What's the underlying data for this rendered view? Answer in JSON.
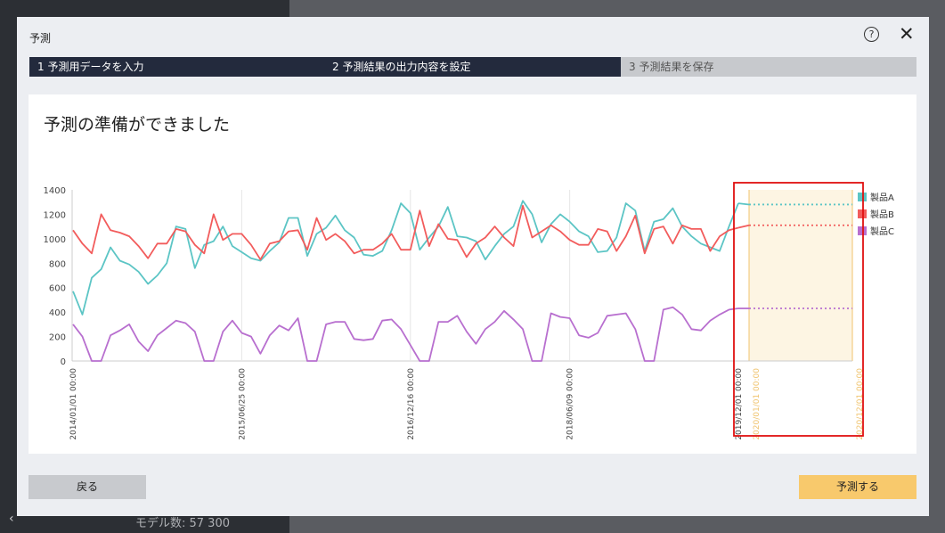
{
  "dialog": {
    "title": "予測",
    "help_glyph": "?",
    "close_glyph": "✕"
  },
  "steps": [
    {
      "label": "1 予測用データを入力",
      "state": "done"
    },
    {
      "label": "2 予測結果の出力内容を設定",
      "state": "current"
    },
    {
      "label": "3 予測結果を保存",
      "state": "pending"
    }
  ],
  "heading": "予測の準備ができました",
  "buttons": {
    "back": "戻る",
    "run": "予測する"
  },
  "background": {
    "status": "モデル数: 57 300",
    "chevron": "‹"
  },
  "colors": {
    "productA": "#5cc5c5",
    "productB": "#f25c5c",
    "productC": "#b86fcf",
    "forecast_fill": "#fdf5e3",
    "forecast_accent": "#f0c36d",
    "highlight_box": "#e01010",
    "step_active": "#232a3d",
    "step_pending": "#c7c9cd"
  },
  "chart_data": {
    "type": "line",
    "ylim": [
      0,
      1400
    ],
    "yticks": [
      0,
      200,
      400,
      600,
      800,
      1000,
      1200,
      1400
    ],
    "xlabels": [
      "2014/01/01 00:00",
      "2015/06/25 00:00",
      "2016/12/16 00:00",
      "2018/06/09 00:00",
      "2019/12/01 00:00"
    ],
    "forecast_xlabels": [
      "2020/01/01 00:00",
      "2020/12/01 00:00"
    ],
    "series": [
      {
        "name": "製品A",
        "values": [
          570,
          380,
          680,
          750,
          930,
          820,
          790,
          730,
          630,
          700,
          800,
          1100,
          1080,
          760,
          950,
          980,
          1100,
          940,
          890,
          840,
          820,
          900,
          970,
          1170,
          1170,
          860,
          1040,
          1090,
          1190,
          1070,
          1010,
          870,
          860,
          900,
          1070,
          1290,
          1210,
          910,
          1010,
          1100,
          1260,
          1020,
          1010,
          980,
          830,
          940,
          1040,
          1100,
          1310,
          1200,
          970,
          1120,
          1200,
          1140,
          1060,
          1020,
          890,
          900,
          1010,
          1290,
          1230,
          900,
          1140,
          1160,
          1250,
          1100,
          1020,
          960,
          930,
          900,
          1100,
          1290
        ],
        "forecast": 1280
      },
      {
        "name": "製品B",
        "values": [
          1070,
          960,
          880,
          1200,
          1070,
          1050,
          1020,
          940,
          840,
          960,
          960,
          1080,
          1060,
          950,
          880,
          1200,
          990,
          1040,
          1040,
          950,
          830,
          960,
          980,
          1060,
          1070,
          910,
          1170,
          990,
          1040,
          980,
          880,
          910,
          910,
          960,
          1040,
          910,
          910,
          1230,
          940,
          1120,
          1000,
          990,
          850,
          960,
          1010,
          1100,
          1010,
          940,
          1270,
          1010,
          1060,
          1110,
          1060,
          990,
          950,
          950,
          1080,
          1060,
          900,
          1020,
          1190,
          880,
          1080,
          1100,
          960,
          1110,
          1080,
          1080,
          900,
          1020,
          1070,
          1090
        ],
        "forecast": 1110
      },
      {
        "name": "製品C",
        "values": [
          300,
          200,
          0,
          0,
          210,
          250,
          300,
          160,
          80,
          210,
          270,
          330,
          310,
          240,
          0,
          0,
          240,
          330,
          230,
          200,
          60,
          210,
          290,
          250,
          350,
          0,
          0,
          300,
          320,
          320,
          180,
          170,
          180,
          330,
          340,
          260,
          130,
          0,
          0,
          320,
          320,
          370,
          240,
          140,
          260,
          320,
          410,
          340,
          260,
          0,
          0,
          390,
          360,
          350,
          210,
          190,
          230,
          370,
          380,
          390,
          260,
          0,
          0,
          420,
          440,
          380,
          260,
          250,
          330,
          380,
          420,
          430
        ],
        "forecast": 430
      }
    ]
  }
}
